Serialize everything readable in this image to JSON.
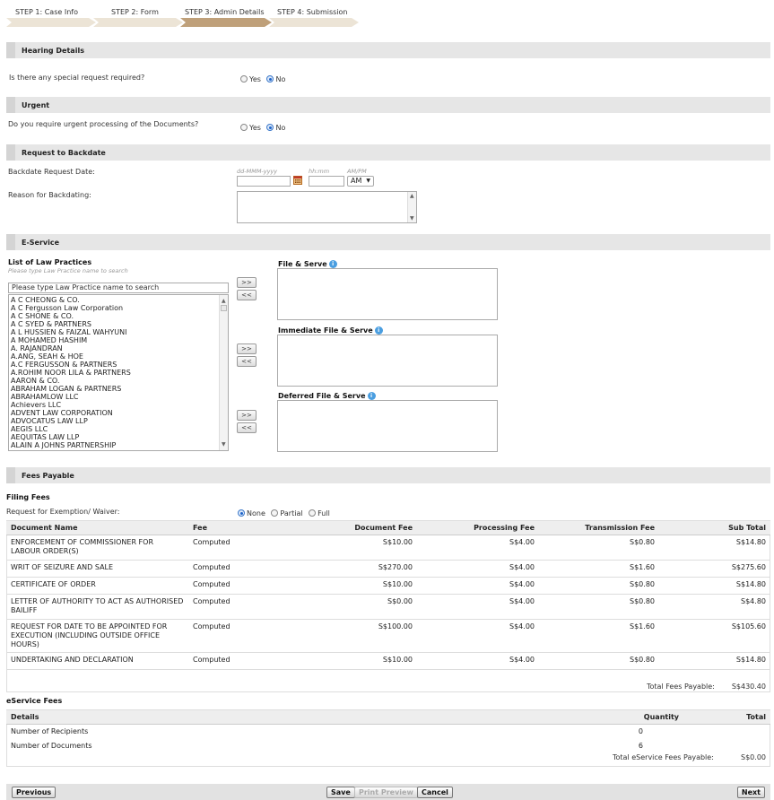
{
  "steps": [
    {
      "label": "STEP 1: Case Info",
      "state": "done"
    },
    {
      "label": "STEP 2: Form",
      "state": "done"
    },
    {
      "label": "STEP 3: Admin Details",
      "state": "current"
    },
    {
      "label": "STEP 4: Submission",
      "state": "pending"
    }
  ],
  "hearing": {
    "title": "Hearing Details",
    "question": "Is there any special request required?",
    "yes": "Yes",
    "no": "No",
    "selected": "No"
  },
  "urgent": {
    "title": "Urgent",
    "question": "Do you require urgent processing of the Documents?",
    "yes": "Yes",
    "no": "No",
    "selected": "No"
  },
  "backdate": {
    "title": "Request to Backdate",
    "date_label": "Backdate Request Date:",
    "date_hint": "dd-MMM-yyyy",
    "time_hint": "hh:mm",
    "ampm_hint": "AM/PM",
    "ampm_value": "AM",
    "reason_label": "Reason for Backdating:"
  },
  "eservice": {
    "title": "E-Service",
    "list_title": "List of Law Practices",
    "list_subtitle": "Please type Law Practice name to search",
    "search_value": "Please type Law Practice name to search",
    "practices": [
      "A C CHEONG & CO.",
      "A C Fergusson Law Corporation",
      "A C SHONE & CO.",
      "A C SYED & PARTNERS",
      "A L HUSSIEN & FAIZAL WAHYUNI",
      "A MOHAMED HASHIM",
      "A. RAJANDRAN",
      "A.ANG, SEAH & HOE",
      "A.C FERGUSSON & PARTNERS",
      "A.ROHIM NOOR LILA & PARTNERS",
      "AARON & CO.",
      "ABRAHAM LOGAN & PARTNERS",
      "ABRAHAMLOW LLC",
      "Achievers LLC",
      "ADVENT LAW CORPORATION",
      "ADVOCATUS LAW LLP",
      "AEGIS LLC",
      "AEQUITAS LAW LLP",
      "ALAIN A JOHNS PARTNERSHIP"
    ],
    "add_label": ">>",
    "remove_label": "<<",
    "file_serve": "File & Serve",
    "immediate": "Immediate File & Serve",
    "deferred": "Deferred File & Serve"
  },
  "fees": {
    "title": "Fees Payable",
    "filing_title": "Filing Fees",
    "exemption_label": "Request for Exemption/ Waiver:",
    "options": [
      "None",
      "Partial",
      "Full"
    ],
    "selected": "None",
    "columns": [
      "Document Name",
      "Fee",
      "Document Fee",
      "Processing Fee",
      "Transmission Fee",
      "Sub Total"
    ],
    "rows": [
      [
        "ENFORCEMENT OF COMMISSIONER FOR LABOUR ORDER(S)",
        "Computed",
        "S$10.00",
        "S$4.00",
        "S$0.80",
        "S$14.80"
      ],
      [
        "WRIT OF SEIZURE AND SALE",
        "Computed",
        "S$270.00",
        "S$4.00",
        "S$1.60",
        "S$275.60"
      ],
      [
        "CERTIFICATE OF ORDER",
        "Computed",
        "S$10.00",
        "S$4.00",
        "S$0.80",
        "S$14.80"
      ],
      [
        "LETTER OF AUTHORITY TO ACT AS AUTHORISED BAILIFF",
        "Computed",
        "S$0.00",
        "S$4.00",
        "S$0.80",
        "S$4.80"
      ],
      [
        "REQUEST FOR DATE TO BE APPOINTED FOR EXECUTION (INCLUDING OUTSIDE OFFICE HOURS)",
        "Computed",
        "S$100.00",
        "S$4.00",
        "S$1.60",
        "S$105.60"
      ],
      [
        "UNDERTAKING AND DECLARATION",
        "Computed",
        "S$10.00",
        "S$4.00",
        "S$0.80",
        "S$14.80"
      ]
    ],
    "total_label": "Total Fees Payable:",
    "total_value": "S$430.40",
    "eservice_title": "eService Fees",
    "es_columns": [
      "Details",
      "Quantity",
      "Total"
    ],
    "es_rows": [
      [
        "Number of Recipients",
        "0"
      ],
      [
        "Number of Documents",
        "6"
      ]
    ],
    "es_total_label": "Total eService Fees Payable:",
    "es_total_value": "S$0.00"
  },
  "footer": {
    "previous": "Previous",
    "save": "Save",
    "print_preview": "Print Preview",
    "cancel": "Cancel",
    "next": "Next"
  },
  "colors": {
    "step_done": "#ece4d6",
    "step_current": "#bfa07a",
    "section_bar": "#e6e6e6"
  }
}
